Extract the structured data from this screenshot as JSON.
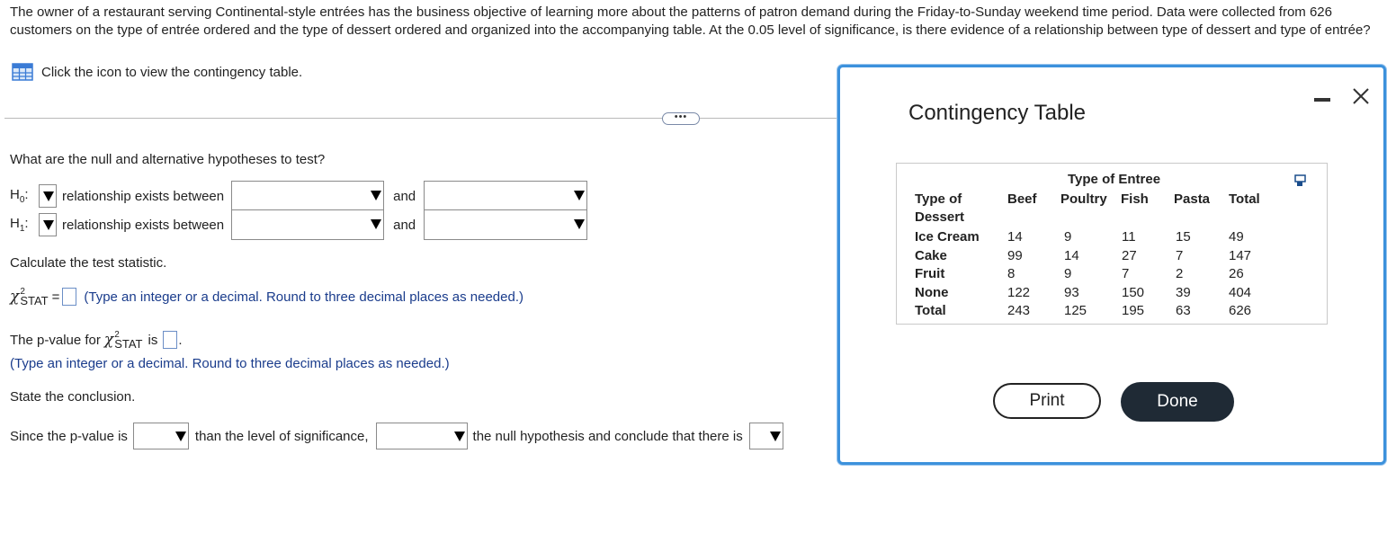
{
  "intro": "The owner of a restaurant serving Continental-style entrées has the business objective of learning more about the patterns of patron demand during the Friday-to-Sunday weekend time period. Data were collected from 626 customers on the type of entrée ordered and the type of dessert ordered and organized into the accompanying table. At the 0.05 level of significance, is there evidence of a relationship between type of dessert and type of entrée?",
  "table_link": "Click the icon to view the contingency table.",
  "more_button": "•••",
  "q_hyp": "What are the null and alternative hypotheses to test?",
  "h0": {
    "symbol": "H",
    "sub": "0",
    "mid": "relationship exists between",
    "and": "and"
  },
  "h1": {
    "symbol": "H",
    "sub": "1",
    "mid": "relationship exists between",
    "and": "and"
  },
  "q_calc": "Calculate the test statistic.",
  "chi_stat": {
    "symbol": "χ",
    "sup": "2",
    "sub": "STAT",
    "eq": "=",
    "note": "(Type an integer or a decimal. Round to three decimal places as needed.)"
  },
  "pvalue": {
    "prefix": "The p-value for",
    "is": "is",
    "note": "(Type an integer or a decimal. Round to three decimal places as needed.)"
  },
  "q_conc": "State the conclusion.",
  "conclusion": {
    "a": "Since the p-value is",
    "b": "than the level of significance,",
    "c": "the null hypothesis and conclude that there is"
  },
  "modal": {
    "title": "Contingency Table",
    "group_header": "Type of Entree",
    "row_header_1": "Type of",
    "row_header_2": "Dessert",
    "columns": [
      "Beef",
      "Poultry",
      "Fish",
      "Pasta",
      "Total"
    ],
    "rows": [
      {
        "label": "Ice Cream",
        "values": [
          "14",
          "9",
          "11",
          "15",
          "49"
        ]
      },
      {
        "label": "Cake",
        "values": [
          "99",
          "14",
          "27",
          "7",
          "147"
        ]
      },
      {
        "label": "Fruit",
        "values": [
          "8",
          "9",
          "7",
          "2",
          "26"
        ]
      },
      {
        "label": "None",
        "values": [
          "122",
          "93",
          "150",
          "39",
          "404"
        ]
      },
      {
        "label": "Total",
        "values": [
          "243",
          "125",
          "195",
          "63",
          "626"
        ]
      }
    ],
    "print": "Print",
    "done": "Done"
  },
  "colors": {
    "modal_border": "#3c91dc",
    "done_bg": "#1f2a35",
    "note_blue": "#1a3c8c",
    "input_border": "#6b8ec6"
  }
}
